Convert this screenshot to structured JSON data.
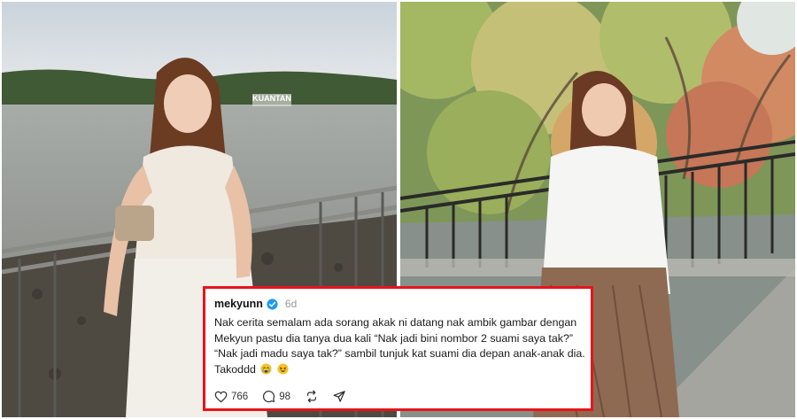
{
  "photos": {
    "left": {
      "sign_text": "KUANTAN"
    },
    "right": {}
  },
  "post": {
    "username": "mekyunn",
    "verified": true,
    "time": "6d",
    "lines": [
      "Nak cerita semalam ada sorang akak ni datang nak ambik gambar dengan",
      "Mekyun pastu dia tanya dua kali “Nak jadi bini nombor 2 suami saya tak?”",
      "“Nak jadi madu saya tak?” sambil tunjuk kat suami dia depan anak-anak dia.",
      "Takoddd"
    ],
    "emojis": [
      "crying-face-emoji",
      "rolling-laughing-emoji"
    ],
    "likes": "766",
    "comments": "98"
  },
  "colors": {
    "highlight_border": "#e8141b",
    "verified_blue": "#1d9bf0"
  }
}
